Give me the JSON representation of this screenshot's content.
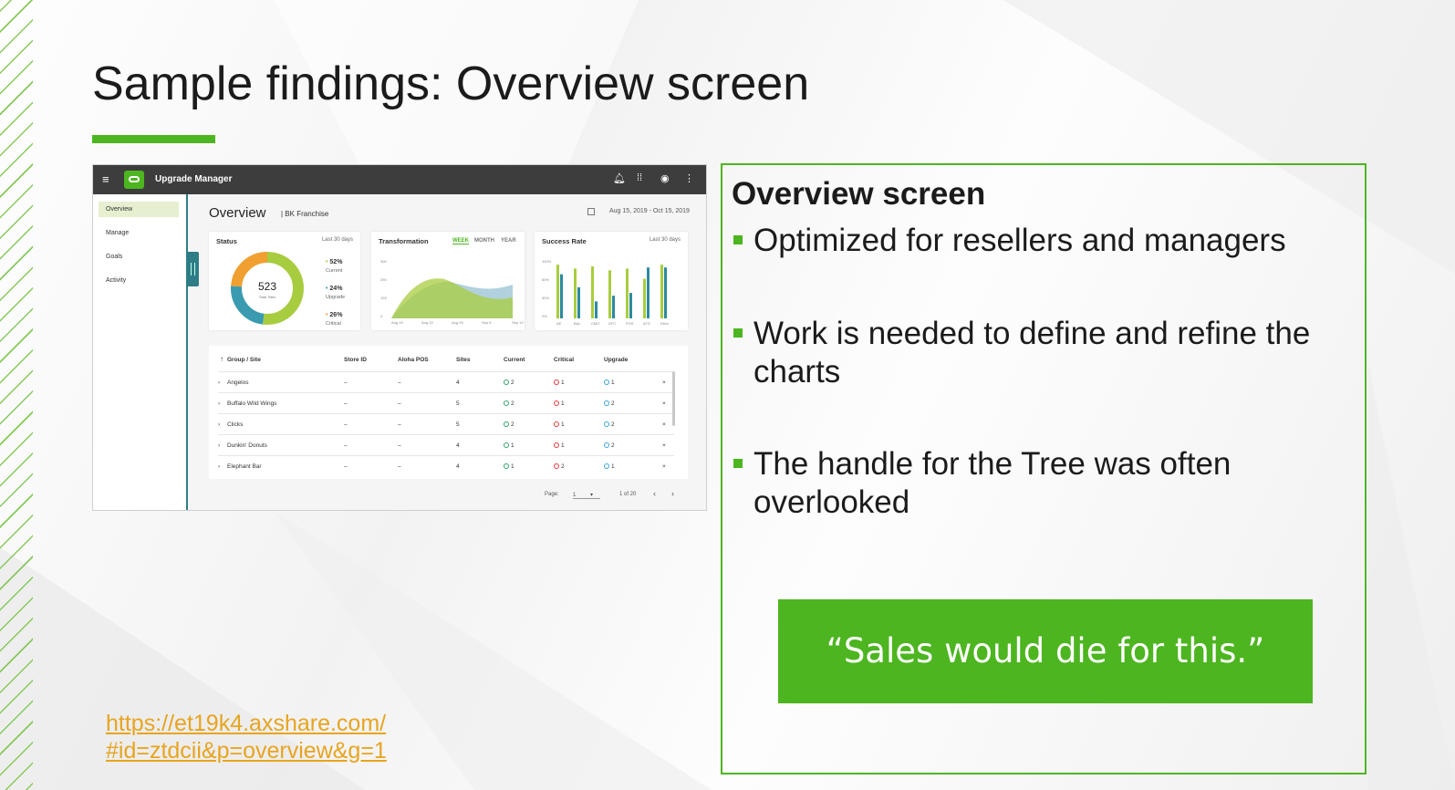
{
  "slide": {
    "title": "Sample findings: Overview screen",
    "link_line1": "https://et19k4.axshare.com/",
    "link_line2": "#id=ztdcii&p=overview&g=1"
  },
  "panel": {
    "heading": "Overview screen",
    "bullets": [
      "Optimized for resellers and managers",
      "Work is needed to define and refine the charts",
      "The handle for the Tree was often overlooked"
    ],
    "quote": "“Sales would die for this.”"
  },
  "screenshot": {
    "app_name": "Upgrade Manager",
    "sidebar": [
      "Overview",
      "Manage",
      "Goals",
      "Activity"
    ],
    "overview_title": "Overview",
    "franchise": "| BK Franchise",
    "date_range": "Aug 15, 2019 - Oct 15, 2019",
    "status": {
      "title": "Status",
      "range": "Last 30 days",
      "total": "523",
      "total_label": "Total Sites",
      "legend": [
        {
          "pct": "52%",
          "label": "Current",
          "color": "#a8cc3f"
        },
        {
          "pct": "24%",
          "label": "Upgrade",
          "color": "#3a9bb0"
        },
        {
          "pct": "26%",
          "label": "Critical",
          "color": "#f0a030"
        }
      ]
    },
    "transformation": {
      "title": "Transformation",
      "tabs": [
        "WEEK",
        "MONTH",
        "YEAR"
      ],
      "yticks": [
        "300",
        "250",
        "125",
        "0"
      ],
      "xticks": [
        "Aug 15",
        "Aug 22",
        "Aug 29",
        "Sep 6",
        "Sep 13"
      ]
    },
    "success": {
      "title": "Success Rate",
      "range": "Last 30 days",
      "yticks": [
        "100%",
        "60%",
        "30%",
        "0%"
      ],
      "xticks": [
        "AE",
        "BAL",
        "CMO",
        "DFC",
        "POS",
        "ATG",
        "Kitch"
      ],
      "green": [
        0.95,
        0.88,
        0.92,
        0.85,
        0.88,
        0.7,
        0.95
      ],
      "teal": [
        0.78,
        0.55,
        0.3,
        0.4,
        0.45,
        0.9,
        0.9
      ]
    },
    "table": {
      "headers": [
        "Group / Site",
        "Store ID",
        "Aloha POS",
        "Sites",
        "Current",
        "Critical",
        "Upgrade"
      ],
      "rows": [
        {
          "name": "Angelos",
          "store": "–",
          "pos": "–",
          "sites": "4",
          "current": "2",
          "critical": "1",
          "upgrade": "1"
        },
        {
          "name": "Buffalo Wild Wings",
          "store": "–",
          "pos": "–",
          "sites": "5",
          "current": "2",
          "critical": "1",
          "upgrade": "2"
        },
        {
          "name": "Clicks",
          "store": "–",
          "pos": "–",
          "sites": "5",
          "current": "2",
          "critical": "1",
          "upgrade": "2"
        },
        {
          "name": "Dunkin' Donuts",
          "store": "–",
          "pos": "–",
          "sites": "4",
          "current": "1",
          "critical": "1",
          "upgrade": "2"
        },
        {
          "name": "Elephant Bar",
          "store": "–",
          "pos": "–",
          "sites": "4",
          "current": "1",
          "critical": "2",
          "upgrade": "1"
        }
      ],
      "page_label": "Page:",
      "page_value": "1",
      "page_of": "1 of 20"
    }
  }
}
